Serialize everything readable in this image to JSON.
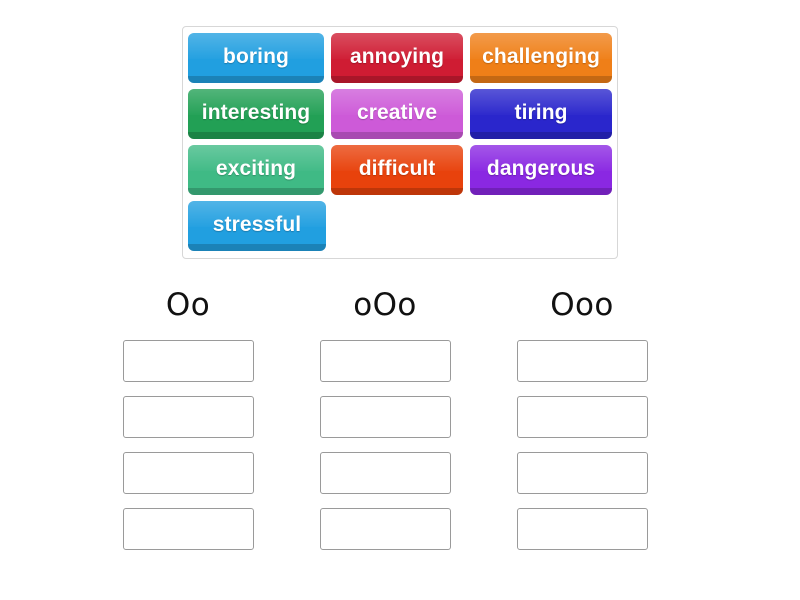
{
  "activity": {
    "type": "word-sort-drag-and-drop",
    "word_bank": {
      "rows": [
        [
          {
            "label": "boring",
            "color": "#219fe0"
          },
          {
            "label": "annoying",
            "color": "#cf1c33"
          },
          {
            "label": "challenging",
            "color": "#ef7f18"
          }
        ],
        [
          {
            "label": "interesting",
            "color": "#22a055"
          },
          {
            "label": "creative",
            "color": "#cd5ad8"
          },
          {
            "label": "tiring",
            "color": "#2a26cc"
          }
        ],
        [
          {
            "label": "exciting",
            "color": "#3fba85"
          },
          {
            "label": "difficult",
            "color": "#e8420c"
          },
          {
            "label": "dangerous",
            "color": "#8a28e2"
          }
        ],
        [
          {
            "label": "stressful",
            "color": "#219fe0"
          }
        ]
      ]
    },
    "columns": [
      {
        "header": "Oo",
        "slots": [
          "",
          "",
          "",
          ""
        ]
      },
      {
        "header": "oOo",
        "slots": [
          "",
          "",
          "",
          ""
        ]
      },
      {
        "header": "Ooo",
        "slots": [
          "",
          "",
          "",
          ""
        ]
      }
    ],
    "panel_border_color": "#d7d7d7",
    "slot_border_color": "#9a9a9a",
    "background_color": "#ffffff"
  }
}
